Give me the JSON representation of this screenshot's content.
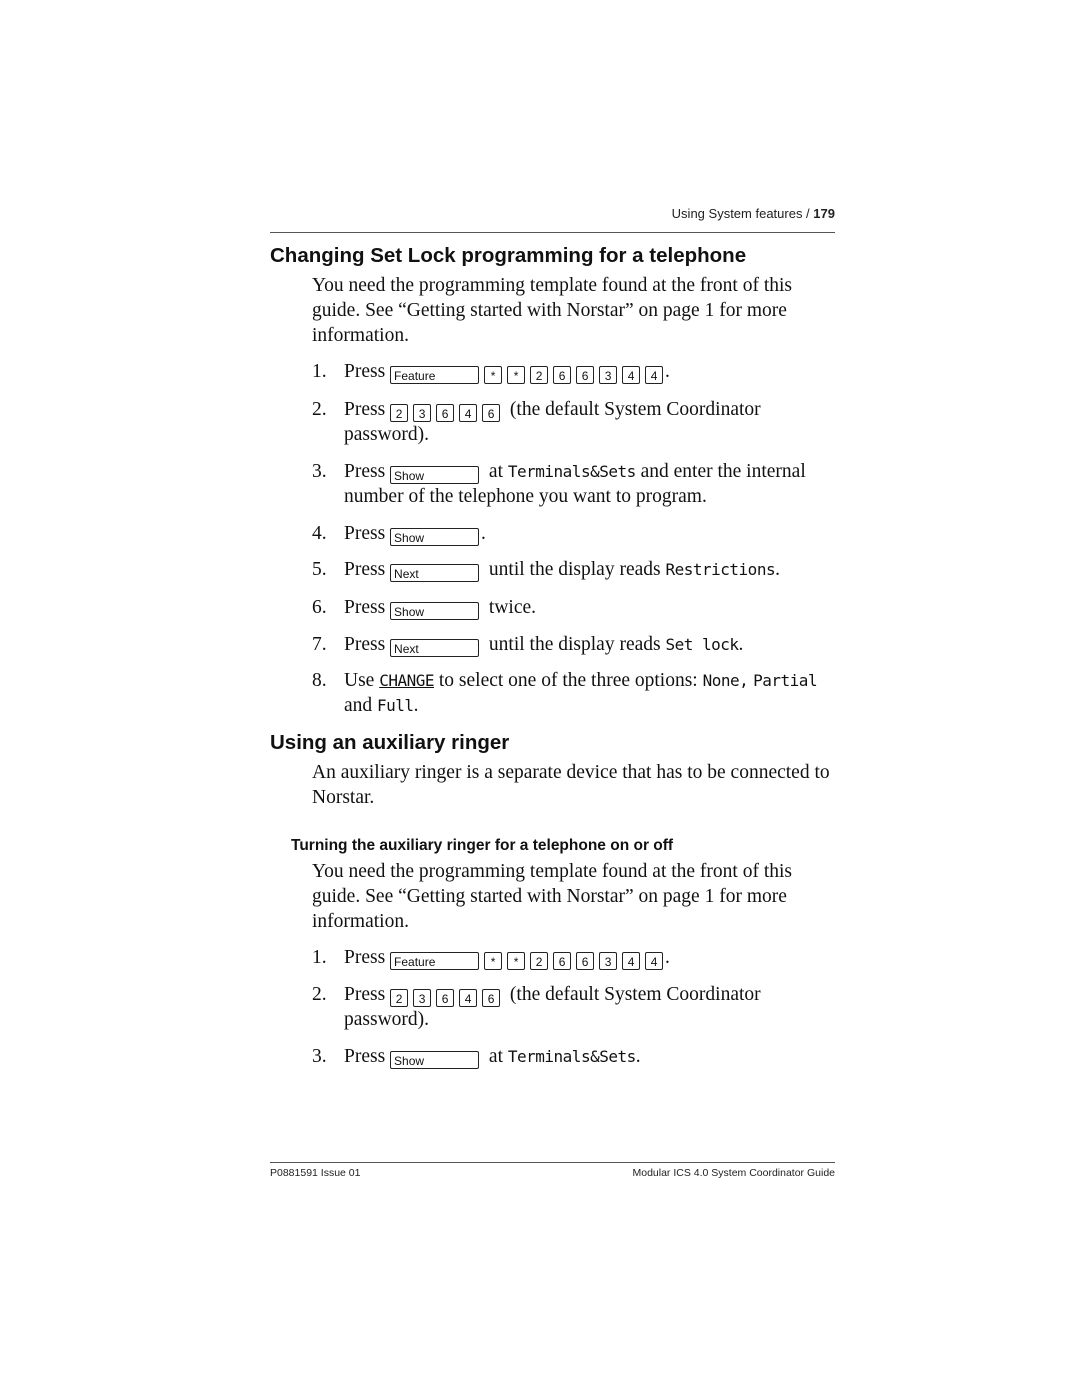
{
  "header": {
    "section": "Using System features / ",
    "page_number": "179"
  },
  "section1": {
    "title": "Changing Set Lock programming for a telephone",
    "intro": "You need the programming template found at the front of this guide. See “Getting started with Norstar”  on page 1 for more information.",
    "steps": [
      {
        "num": "1.",
        "press": "Press",
        "feature_key": "Feature",
        "keys": [
          "*",
          "*",
          "2",
          "6",
          "6",
          "3",
          "4",
          "4"
        ],
        "after": "."
      },
      {
        "num": "2.",
        "press": "Press",
        "keys": [
          "2",
          "3",
          "6",
          "4",
          "6"
        ],
        "after": "(the default System Coordinator password)."
      },
      {
        "num": "3.",
        "press": "Press",
        "key": "Show",
        "text1": "at",
        "lcd": "Terminals&Sets",
        "text2": "and enter the internal number of the telephone you want to program."
      },
      {
        "num": "4.",
        "press": "Press",
        "key": "Show",
        "after": "."
      },
      {
        "num": "5.",
        "press": "Press",
        "key": "Next",
        "text1": "until the display reads",
        "lcd": "Restrictions",
        "after": "."
      },
      {
        "num": "6.",
        "press": "Press",
        "key": "Show",
        "after": "twice."
      },
      {
        "num": "7.",
        "press": "Press",
        "key": "Next",
        "text1": "until the display reads",
        "lcd": "Set lock",
        "after": "."
      },
      {
        "num": "8.",
        "use": "Use",
        "lcd_button": "CHANGE",
        "text1": "to select one of the three options:",
        "opt1": "None,",
        "opt2": "Partial",
        "and": "and",
        "opt3": "Full",
        "after": "."
      }
    ]
  },
  "section2": {
    "title": "Using an auxiliary ringer",
    "intro": "An auxiliary ringer is a separate device that has to be connected to Norstar.",
    "subtitle": "Turning the auxiliary ringer for a telephone on or off",
    "sub_intro": "You need the programming template found at the front of this guide. See “Getting started with Norstar”  on page 1 for more information.",
    "steps": [
      {
        "num": "1.",
        "press": "Press",
        "feature_key": "Feature",
        "keys": [
          "*",
          "*",
          "2",
          "6",
          "6",
          "3",
          "4",
          "4"
        ],
        "after": "."
      },
      {
        "num": "2.",
        "press": "Press",
        "keys": [
          "2",
          "3",
          "6",
          "4",
          "6"
        ],
        "after": "(the default System Coordinator password)."
      },
      {
        "num": "3.",
        "press": "Press",
        "key": "Show",
        "text1": "at",
        "lcd": "Terminals&Sets",
        "after": "."
      }
    ]
  },
  "footer": {
    "left": "P0881591 Issue 01",
    "right": "Modular ICS 4.0 System Coordinator Guide"
  }
}
